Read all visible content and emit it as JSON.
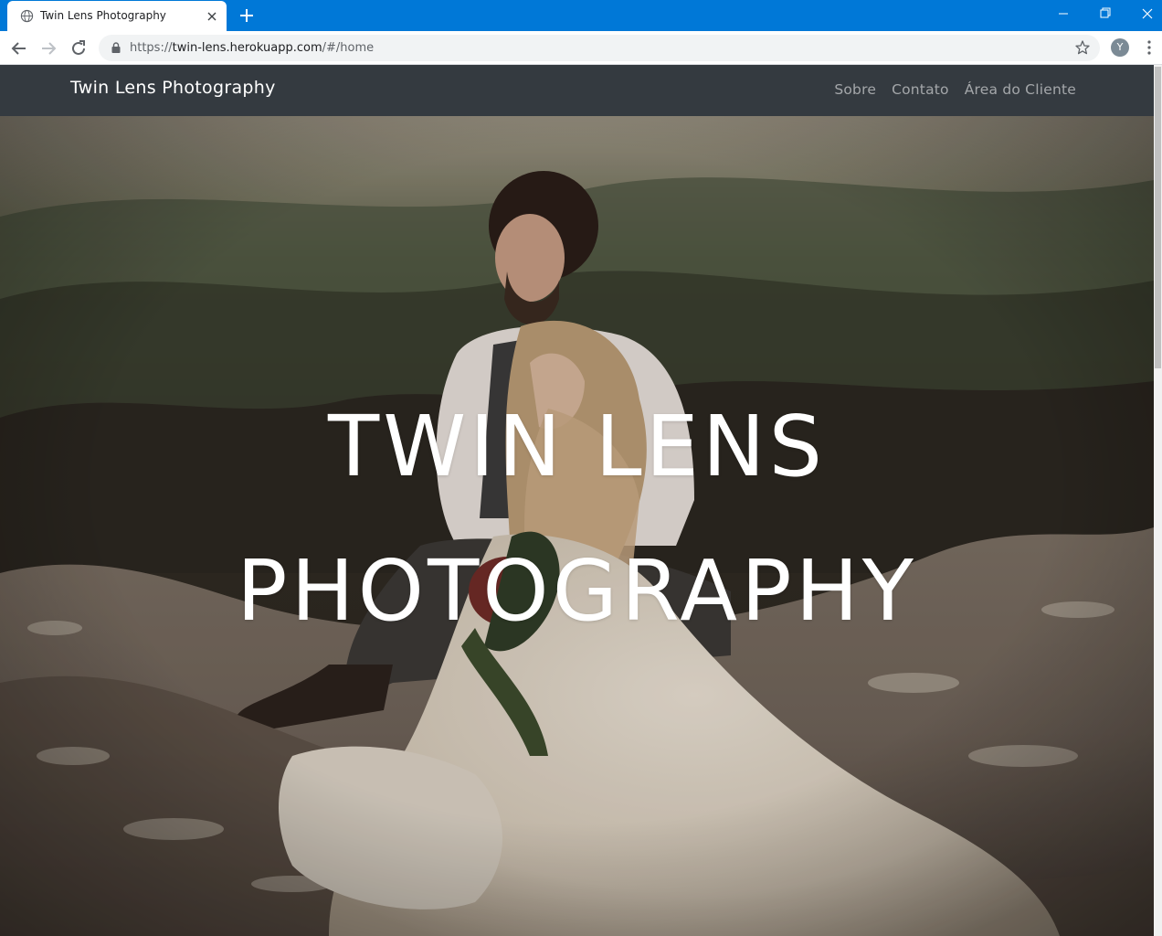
{
  "browser": {
    "tab_title": "Twin Lens Photography",
    "url_prefix": "https://",
    "url_host": "twin-lens.herokuapp.com",
    "url_path": "/#/home",
    "profile_initial": "Y",
    "accent_color": "#0078d7"
  },
  "navbar": {
    "brand": "Twin Lens Photography",
    "links": [
      {
        "label": "Sobre"
      },
      {
        "label": "Contato"
      },
      {
        "label": "Área do Cliente"
      }
    ],
    "background": "#343a40"
  },
  "hero": {
    "title_line1": "TWIN LENS",
    "title_line2": "PHOTOGRAPHY",
    "photo": "couple-on-rocks-photo"
  },
  "icons": {
    "favicon": "globe-icon",
    "tab_close": "close-icon",
    "new_tab": "plus-icon",
    "back": "arrow-left-icon",
    "forward": "arrow-right-icon",
    "reload": "reload-icon",
    "lock": "lock-icon",
    "bookmark": "star-icon",
    "menu": "kebab-menu-icon"
  }
}
